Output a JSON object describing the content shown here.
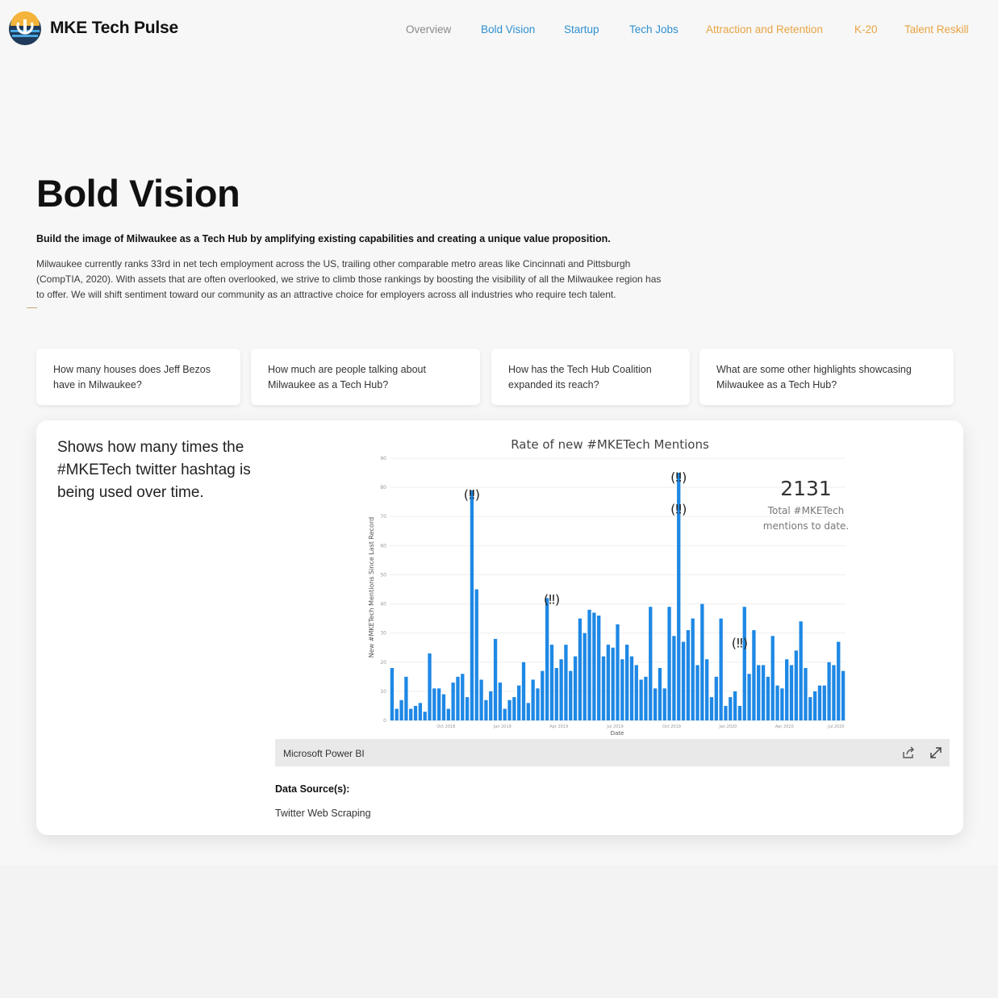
{
  "header": {
    "brand": "MKE Tech Pulse",
    "nav": [
      {
        "label": "Overview"
      },
      {
        "label": "Bold Vision"
      },
      {
        "label": "Startup"
      },
      {
        "label": "Tech Jobs"
      },
      {
        "label": "Attraction and Retention"
      },
      {
        "label": "K-20"
      },
      {
        "label": "Talent Reskill"
      }
    ],
    "colors": {
      "muted": "#8a8a8a",
      "blue": "#2f8fcf",
      "orange": "#e7a443"
    }
  },
  "main": {
    "title": "Bold Vision",
    "subtitle": "Build the image of Milwaukee as a Tech Hub by amplifying existing capabilities and creating a unique value proposition.",
    "body": "Milwaukee currently ranks 33rd in net tech employment across the US, trailing other comparable metro areas like Cincinnati and Pittsburgh (CompTIA, 2020).  With assets that are often overlooked, we strive to climb those rankings by boosting the visibility of all the Milwaukee region has to offer.  We will shift sentiment toward our community as an attractive choice for employers across all industries who require tech talent.",
    "questions": [
      {
        "text": "How many houses does Jeff Bezos have in Milwaukee?"
      },
      {
        "text": "How much are people talking about Milwaukee as a Tech Hub?"
      },
      {
        "text": "How has the Tech Hub Coalition expanded its reach?"
      },
      {
        "text": "What are some other highlights showcasing Milwaukee as a Tech Hub?"
      }
    ]
  },
  "panel": {
    "description": "Shows how many times the #MKETech twitter hashtag is being used over time.",
    "powerbi_label": "Microsoft Power BI",
    "share_icon": "share-icon",
    "expand_icon": "expand-icon",
    "data_source_label": "Data Source(s):",
    "data_source_value": "Twitter Web Scraping"
  },
  "chart_data": {
    "type": "bar",
    "title": "Rate of new #MKETech Mentions",
    "xlabel": "Date",
    "ylabel": "New #MKETech Mentions Since Last Record",
    "ylim": [
      0,
      90
    ],
    "yticks": [
      "0",
      "10",
      "20",
      "30",
      "40",
      "50",
      "60",
      "70",
      "80",
      "90"
    ],
    "xticks": [
      "Oct 2018",
      "Jan 2019",
      "Apr 2019",
      "Jul 2019",
      "Oct 2019",
      "Jan 2020",
      "Apr 2020",
      "Jul 2020"
    ],
    "bar_color": "#1e88e5",
    "values": [
      18,
      4,
      7,
      15,
      4,
      5,
      6,
      3,
      23,
      11,
      11,
      9,
      4,
      13,
      15,
      16,
      8,
      79,
      45,
      14,
      7,
      10,
      28,
      13,
      4,
      7,
      8,
      12,
      20,
      6,
      14,
      11,
      17,
      42,
      26,
      18,
      21,
      26,
      17,
      22,
      35,
      30,
      38,
      37,
      36,
      22,
      26,
      25,
      33,
      21,
      26,
      22,
      19,
      14,
      15,
      39,
      11,
      18,
      11,
      39,
      29,
      85,
      27,
      31,
      35,
      19,
      40,
      21,
      8,
      15,
      35,
      5,
      8,
      10,
      5,
      39,
      16,
      31,
      19,
      19,
      15,
      29,
      12,
      11,
      21,
      19,
      24,
      34,
      18,
      8,
      10,
      12,
      12,
      20,
      19,
      27,
      17
    ],
    "annotations": [
      {
        "text": "(‼)",
        "x_index": 17,
        "y": 76
      },
      {
        "text": "(‼)",
        "x_index": 34,
        "y": 40
      },
      {
        "text": "(‼)",
        "x_index": 61,
        "y": 82
      },
      {
        "text": "(‼)",
        "x_index": 61,
        "y": 71
      },
      {
        "text": "(‼)",
        "x_index": 74,
        "y": 25
      }
    ],
    "kpi": {
      "value": "2131",
      "label": "Total #MKETech mentions to date."
    },
    "grid": true,
    "legend": "none"
  }
}
